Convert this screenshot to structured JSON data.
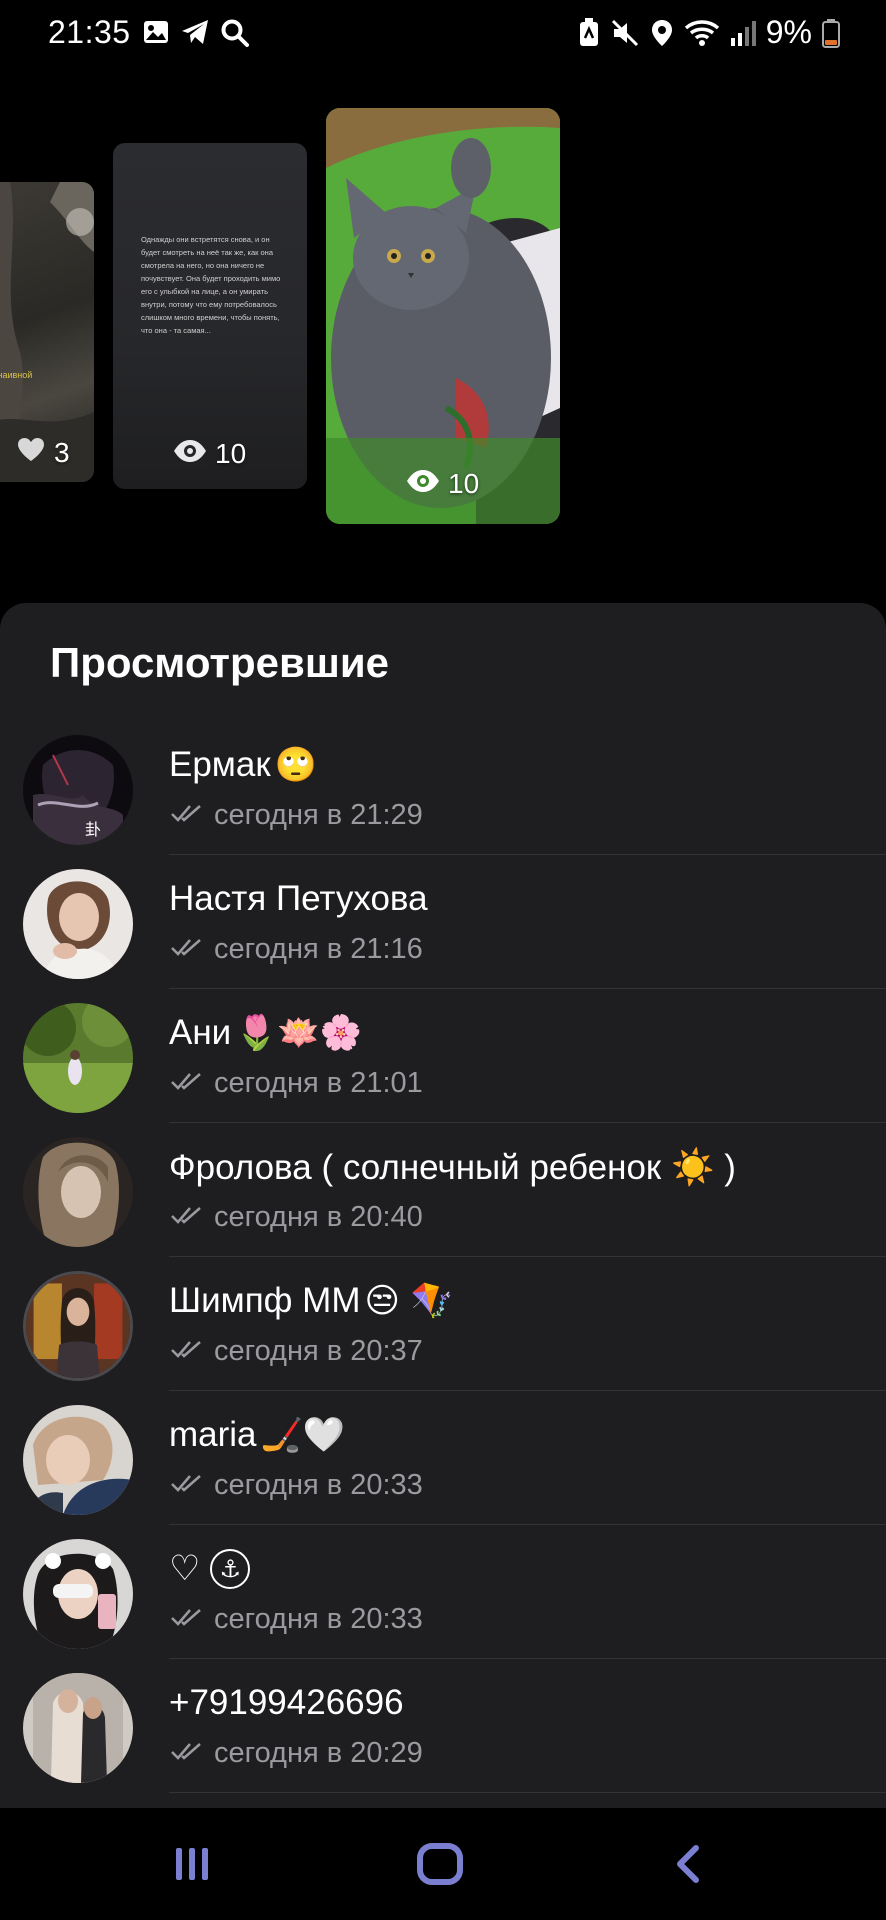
{
  "status_bar": {
    "time": "21:35",
    "battery": "9%",
    "left_icons": [
      "gallery-icon",
      "telegram-icon",
      "search-icon"
    ],
    "right_icons": [
      "nfc-icon",
      "mute-icon",
      "location-icon",
      "wifi-icon",
      "signal-icon",
      "battery-icon"
    ],
    "battery_color": "#e0712d"
  },
  "stories": [
    {
      "count_icon": "heart-icon",
      "count": "3",
      "caption": "о наивной"
    },
    {
      "count_icon": "eye-icon",
      "count": "10",
      "text": "Однажды они встретятся снова, и он будет смотреть на неё так же, как она смотрела на него, но она ничего не почувствует. Она будет проходить мимо его с улыбкой на лице, а он умирать внутри, потому что ему потребовалось слишком много времени, чтобы понять, что она - та самая..."
    },
    {
      "count_icon": "eye-icon",
      "count": "10"
    }
  ],
  "sheet": {
    "title": "Просмотревшие",
    "background": "#1e1d20"
  },
  "viewers": [
    {
      "name": "Ермак",
      "emoji": "🙄",
      "time": "сегодня в 21:29"
    },
    {
      "name": "Настя Петухова",
      "emoji": "",
      "time": "сегодня в 21:16"
    },
    {
      "name": "Ани",
      "emoji": "🌷🪷🌸",
      "time": "сегодня в 21:01"
    },
    {
      "name": "Фролова ( солнечный ребенок ☀️ )",
      "emoji": "",
      "time": "сегодня в 20:40"
    },
    {
      "name": "Шимпф ММ",
      "emoji": "😒 🪁",
      "time": "сегодня в 20:37"
    },
    {
      "name": "maria",
      "emoji": "🏒🤍",
      "time": "сегодня в 20:33"
    },
    {
      "name": "♡",
      "emoji": "⚓",
      "time": "сегодня в 20:33"
    },
    {
      "name": "+79199426696",
      "emoji": "",
      "time": "сегодня в 20:29"
    }
  ],
  "nav": {
    "buttons": [
      "recent-apps",
      "home",
      "back"
    ],
    "color": "#7b7fd1"
  }
}
